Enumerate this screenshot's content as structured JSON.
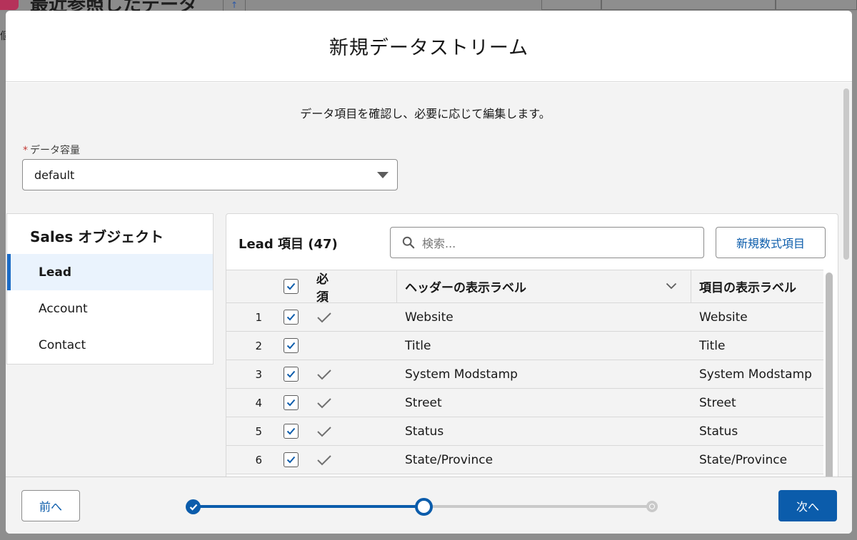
{
  "background": {
    "title": "最近参照したデータ",
    "left_char": "個"
  },
  "modal": {
    "title": "新規データストリーム",
    "intro": "データ項目を確認し、必要に応じて編集します。",
    "capacity_field": {
      "label": "データ容量",
      "required_mark": "*",
      "value": "default"
    },
    "objects": {
      "title": "Sales オブジェクト",
      "items": [
        {
          "label": "Lead",
          "active": true
        },
        {
          "label": "Account",
          "active": false
        },
        {
          "label": "Contact",
          "active": false
        }
      ]
    },
    "fields": {
      "title": "Lead 項目 (47)",
      "search_placeholder": "検索...",
      "new_formula_label": "新規数式項目",
      "columns": {
        "required": "必須",
        "header_label": "ヘッダーの表示ラベル",
        "field_label": "項目の表示ラベル"
      },
      "rows": [
        {
          "num": "1",
          "checked": true,
          "required": true,
          "header": "Website",
          "label": "Website"
        },
        {
          "num": "2",
          "checked": true,
          "required": false,
          "header": "Title",
          "label": "Title"
        },
        {
          "num": "3",
          "checked": true,
          "required": true,
          "header": "System Modstamp",
          "label": "System Modstamp"
        },
        {
          "num": "4",
          "checked": true,
          "required": true,
          "header": "Street",
          "label": "Street"
        },
        {
          "num": "5",
          "checked": true,
          "required": true,
          "header": "Status",
          "label": "Status"
        },
        {
          "num": "6",
          "checked": true,
          "required": true,
          "header": "State/Province",
          "label": "State/Province"
        }
      ]
    },
    "footer": {
      "prev_label": "前へ",
      "next_label": "次へ",
      "steps": [
        "done",
        "current",
        "todo"
      ],
      "progress": 0.5
    }
  },
  "colors": {
    "brand": "#0b5cab",
    "active_bg": "#eaf3fd",
    "required": "#c23934"
  }
}
